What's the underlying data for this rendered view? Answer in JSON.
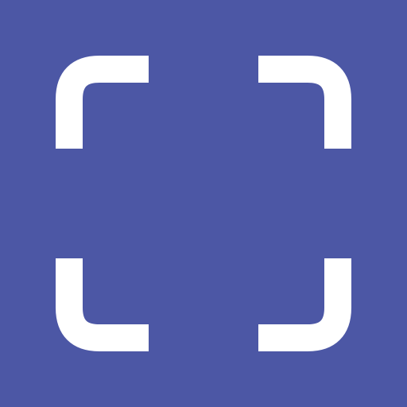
{
  "app_icon": {
    "icon_name": "scan-frame-icon",
    "background_color": "#4c57a5",
    "foreground_color": "#ffffff"
  }
}
